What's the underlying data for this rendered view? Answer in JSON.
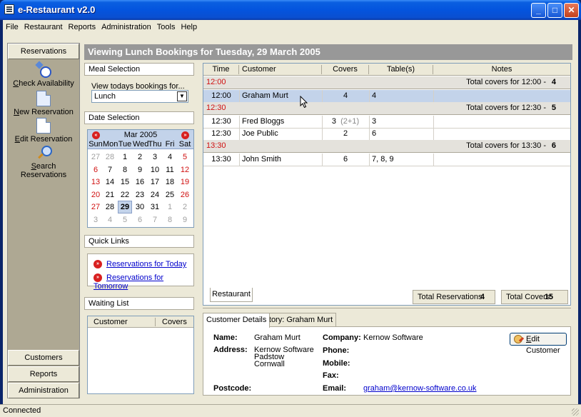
{
  "window": {
    "title": "e-Restaurant v2.0",
    "min": "_",
    "max": "□",
    "close": "✕"
  },
  "menu": [
    "File",
    "Restaurant",
    "Reports",
    "Administration",
    "Tools",
    "Help"
  ],
  "nav": {
    "top_button": "Reservations",
    "items": [
      {
        "prefix": "",
        "ul": "C",
        "rest": "heck Availability",
        "icon": "clock-icon"
      },
      {
        "prefix": "",
        "ul": "N",
        "rest": "ew Reservation",
        "icon": "document-icon"
      },
      {
        "prefix": "",
        "ul": "E",
        "rest": "dit Reservation",
        "icon": "document-icon"
      },
      {
        "prefix": "",
        "ul": "S",
        "rest": "earch Reservations",
        "icon": "search-icon"
      }
    ],
    "bottom_buttons": [
      "Customers",
      "Reports",
      "Administration"
    ]
  },
  "view_title": "Viewing Lunch Bookings for Tuesday, 29 March 2005",
  "meal": {
    "header": "Meal Selection",
    "label": "View todays bookings for...",
    "value": "Lunch"
  },
  "date": {
    "header": "Date Selection"
  },
  "calendar": {
    "month": "Mar 2005",
    "prev": "«",
    "next": "»",
    "dow": [
      "Sun",
      "Mon",
      "Tue",
      "Wed",
      "Thu",
      "Fri",
      "Sat"
    ],
    "weeks": [
      [
        "27",
        "28",
        "1",
        "2",
        "3",
        "4",
        "5"
      ],
      [
        "6",
        "7",
        "8",
        "9",
        "10",
        "11",
        "12"
      ],
      [
        "13",
        "14",
        "15",
        "16",
        "17",
        "18",
        "19"
      ],
      [
        "20",
        "21",
        "22",
        "23",
        "24",
        "25",
        "26"
      ],
      [
        "27",
        "28",
        "29",
        "30",
        "31",
        "1",
        "2"
      ],
      [
        "3",
        "4",
        "5",
        "6",
        "7",
        "8",
        "9"
      ]
    ],
    "selected": "29"
  },
  "quick_links": {
    "header": "Quick Links",
    "items": [
      "Reservations for Today",
      "Reservations for Tomorrow"
    ]
  },
  "waiting_list": {
    "header": "Waiting List",
    "columns": [
      "Customer",
      "Covers"
    ]
  },
  "grid": {
    "columns": [
      "Time",
      "Customer",
      "Covers",
      "Table(s)",
      "Notes"
    ],
    "groups": [
      {
        "time": "12:00",
        "total_label": "Total covers for 12:00  -",
        "total": "4",
        "rows": [
          {
            "time": "12:00",
            "customer": "Graham Murt",
            "covers": "4",
            "extra": "",
            "tables": "4",
            "notes": ""
          }
        ]
      },
      {
        "time": "12:30",
        "total_label": "Total covers for 12:30  -",
        "total": "5",
        "rows": [
          {
            "time": "12:30",
            "customer": "Fred Bloggs",
            "covers": "3",
            "extra": "(2+1)",
            "tables": "3",
            "notes": ""
          },
          {
            "time": "12:30",
            "customer": "Joe Public",
            "covers": "2",
            "extra": "",
            "tables": "6",
            "notes": ""
          }
        ]
      },
      {
        "time": "13:30",
        "total_label": "Total covers for 13:30  -",
        "total": "6",
        "rows": [
          {
            "time": "13:30",
            "customer": "John Smith",
            "covers": "6",
            "extra": "",
            "tables": "7, 8, 9",
            "notes": ""
          }
        ]
      }
    ]
  },
  "grid_tab": "Restaurant",
  "totals": {
    "res_label": "Total Reservations:",
    "res_value": "4",
    "cov_label": "Total Covers:",
    "cov_value": "15"
  },
  "detail_tabs": [
    "Customer Details",
    "History: Graham Murt"
  ],
  "customer": {
    "name_label": "Name:",
    "name": "Graham Murt",
    "address_label": "Address:",
    "address": [
      "Kernow Software",
      "Padstow",
      "Cornwall"
    ],
    "postcode_label": "Postcode:",
    "company_label": "Company:",
    "company": "Kernow Software",
    "phone_label": "Phone:",
    "mobile_label": "Mobile:",
    "fax_label": "Fax:",
    "email_label": "Email:",
    "email": "graham@kernow-software.co.uk",
    "edit_ul": "E",
    "edit_rest": "dit Customer"
  },
  "status": "Connected"
}
